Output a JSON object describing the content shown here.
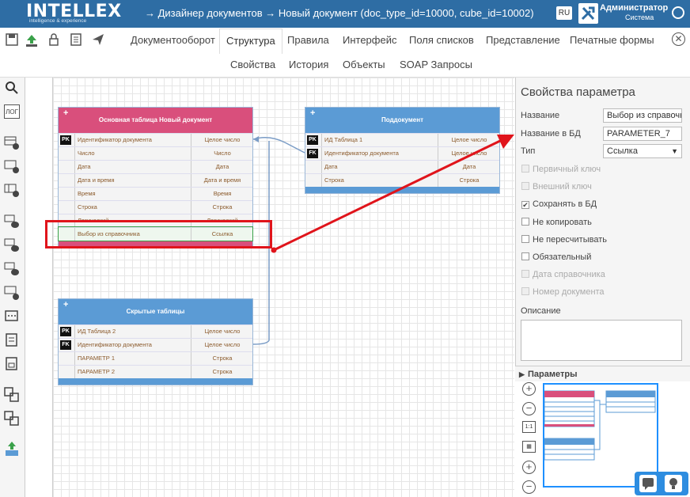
{
  "header": {
    "logo": "INTELLEX",
    "logo_tagline": "intelligence & experience",
    "breadcrumb": "→  Дизайнер документов  →  Новый документ (doc_type_id=10000, cube_id=10002)",
    "lang": "RU",
    "user_role": "Администратор",
    "user_sub": "Система"
  },
  "tabs": [
    "Документооборот",
    "Структура",
    "Правила",
    "Интерфейс",
    "Поля списков",
    "Представление",
    "Печатные формы"
  ],
  "active_tab": "Структура",
  "subtabs": [
    "Свойства",
    "История",
    "Объекты",
    "SOAP Запросы"
  ],
  "leftbar": {
    "log_label": "ЛОГ"
  },
  "tables": {
    "main": {
      "title": "Основная таблица Новый документ",
      "color": "#d94f7c",
      "rows": [
        {
          "key": "PK",
          "name": "Идентификатор документа",
          "type": "Целое число"
        },
        {
          "key": "",
          "name": "Число",
          "type": "Число"
        },
        {
          "key": "",
          "name": "Дата",
          "type": "Дата"
        },
        {
          "key": "",
          "name": "Дата и время",
          "type": "Дата и время"
        },
        {
          "key": "",
          "name": "Время",
          "type": "Время"
        },
        {
          "key": "",
          "name": "Строка",
          "type": "Строка"
        },
        {
          "key": "",
          "name": "Логический",
          "type": "Логический"
        },
        {
          "key": "",
          "name": "Выбор из справочника",
          "type": "Ссылка"
        }
      ]
    },
    "sub": {
      "title": "Поддокумент",
      "color": "#5b9bd5",
      "rows": [
        {
          "key": "PK",
          "name": "ИД Таблица 1",
          "type": "Целое число"
        },
        {
          "key": "FK",
          "name": "Идентификатор документа",
          "type": "Целое число"
        },
        {
          "key": "",
          "name": "Дата",
          "type": "Дата"
        },
        {
          "key": "",
          "name": "Строка",
          "type": "Строка"
        }
      ]
    },
    "hidden": {
      "title": "Скрытые таблицы",
      "color": "#5b9bd5",
      "rows": [
        {
          "key": "PK",
          "name": "ИД Таблица 2",
          "type": "Целое число"
        },
        {
          "key": "FK",
          "name": "Идентификатор документа",
          "type": "Целое число"
        },
        {
          "key": "",
          "name": "ПАРАМЕТР 1",
          "type": "Строка"
        },
        {
          "key": "",
          "name": "ПАРАМЕТР 2",
          "type": "Строка"
        }
      ]
    }
  },
  "props": {
    "title": "Свойства параметра",
    "name_label": "Название",
    "name_value": "Выбор из справочника",
    "dbname_label": "Название в БД",
    "dbname_value": "PARAMETER_7",
    "type_label": "Тип",
    "type_value": "Ссылка",
    "checkboxes": [
      {
        "label": "Первичный ключ",
        "checked": false,
        "disabled": true
      },
      {
        "label": "Внешний ключ",
        "checked": false,
        "disabled": true
      },
      {
        "label": "Сохранять в БД",
        "checked": true,
        "disabled": false
      },
      {
        "label": "Не копировать",
        "checked": false,
        "disabled": false
      },
      {
        "label": "Не пересчитывать",
        "checked": false,
        "disabled": false
      },
      {
        "label": "Обязательный",
        "checked": false,
        "disabled": false
      },
      {
        "label": "Дата справочника",
        "checked": false,
        "disabled": true
      },
      {
        "label": "Номер документа",
        "checked": false,
        "disabled": true
      }
    ],
    "desc_label": "Описание"
  },
  "params_section": "Параметры",
  "zoom_reset": "1:1"
}
